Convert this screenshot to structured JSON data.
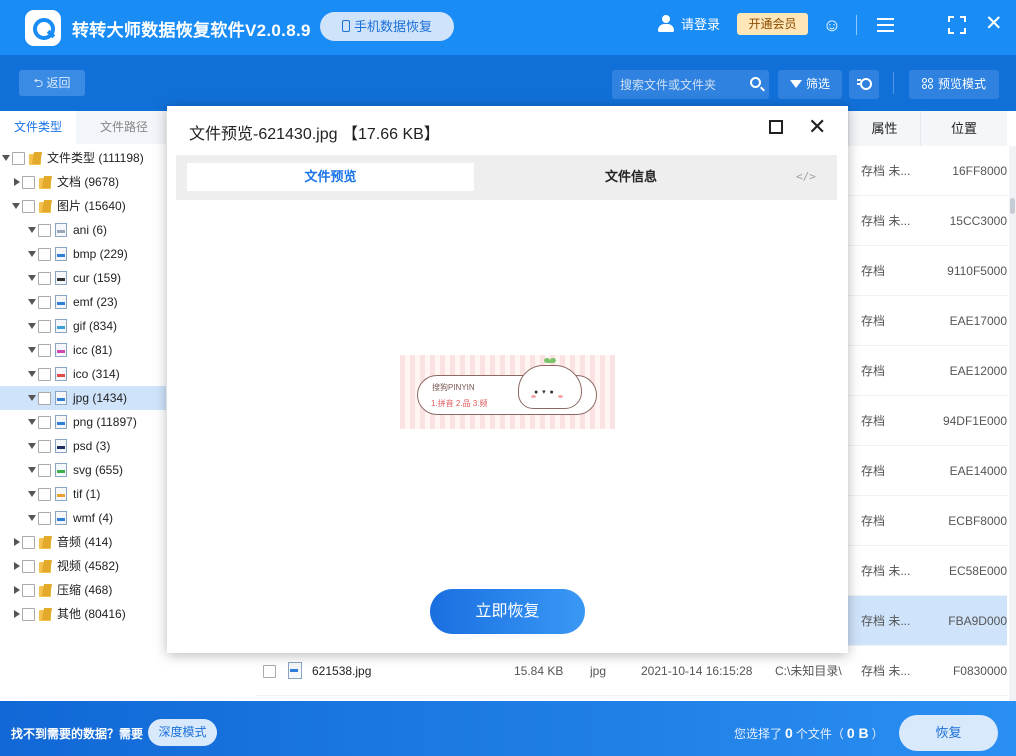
{
  "app": {
    "title": "转转大师数据恢复软件V2.0.8.9",
    "mobile_btn": "手机数据恢复",
    "login": "请登录",
    "vip": "开通会员"
  },
  "toolbar": {
    "back": "返回",
    "search_placeholder": "搜索文件或文件夹",
    "filter": "筛选",
    "preview_mode": "预览模式"
  },
  "left_tabs": {
    "file_type": "文件类型",
    "file_path": "文件路径"
  },
  "tree": [
    {
      "label": "文件类型 (111198)",
      "level": 0,
      "expand": "down",
      "icon": "folder"
    },
    {
      "label": "文档 (9678)",
      "level": 1,
      "expand": "right",
      "icon": "folder"
    },
    {
      "label": "图片 (15640)",
      "level": 1,
      "expand": "down",
      "icon": "folder"
    },
    {
      "label": "ani (6)",
      "level": 2,
      "expand": "down",
      "icon": "file",
      "color": "#9aa8b8"
    },
    {
      "label": "bmp (229)",
      "level": 2,
      "expand": "down",
      "icon": "file",
      "color": "#2f7fd8"
    },
    {
      "label": "cur (159)",
      "level": 2,
      "expand": "down",
      "icon": "file",
      "color": "#333333"
    },
    {
      "label": "emf (23)",
      "level": 2,
      "expand": "down",
      "icon": "file",
      "color": "#2f7fd8"
    },
    {
      "label": "gif (834)",
      "level": 2,
      "expand": "down",
      "icon": "file",
      "color": "#3aa0d8"
    },
    {
      "label": "icc (81)",
      "level": 2,
      "expand": "down",
      "icon": "file",
      "color": "#d04ab0"
    },
    {
      "label": "ico (314)",
      "level": 2,
      "expand": "down",
      "icon": "file",
      "color": "#e04848"
    },
    {
      "label": "jpg (1434)",
      "level": 2,
      "expand": "down",
      "icon": "file",
      "color": "#2f7fd8",
      "selected": true
    },
    {
      "label": "png (11897)",
      "level": 2,
      "expand": "down",
      "icon": "file",
      "color": "#2f7fd8"
    },
    {
      "label": "psd (3)",
      "level": 2,
      "expand": "down",
      "icon": "file",
      "color": "#1b2f5e"
    },
    {
      "label": "svg (655)",
      "level": 2,
      "expand": "down",
      "icon": "file",
      "color": "#3cb04a"
    },
    {
      "label": "tif (1)",
      "level": 2,
      "expand": "down",
      "icon": "file",
      "color": "#e8a030"
    },
    {
      "label": "wmf (4)",
      "level": 2,
      "expand": "down",
      "icon": "file",
      "color": "#2f7fd8"
    },
    {
      "label": "音频 (414)",
      "level": 1,
      "expand": "right",
      "icon": "folder"
    },
    {
      "label": "视频 (4582)",
      "level": 1,
      "expand": "right",
      "icon": "folder"
    },
    {
      "label": "压缩 (468)",
      "level": 1,
      "expand": "right",
      "icon": "folder"
    },
    {
      "label": "其他 (80416)",
      "level": 1,
      "expand": "right",
      "icon": "folder"
    }
  ],
  "table": {
    "columns": {
      "attr": "属性",
      "position": "位置"
    },
    "rows": [
      {
        "attr": "存档 未...",
        "pos": "16FF8000"
      },
      {
        "attr": "存档 未...",
        "pos": "15CC3000"
      },
      {
        "attr": "存档",
        "pos": "9110F5000"
      },
      {
        "attr": "存档",
        "pos": "EAE17000"
      },
      {
        "attr": "存档",
        "pos": "EAE12000"
      },
      {
        "attr": "存档",
        "pos": "94DF1E000"
      },
      {
        "attr": "存档",
        "pos": "EAE14000"
      },
      {
        "attr": "存档",
        "pos": "ECBF8000"
      },
      {
        "attr": "存档 未...",
        "pos": "EC58E000"
      },
      {
        "attr": "存档 未...",
        "pos": "FBA9D000",
        "selected": true
      }
    ],
    "last_row": {
      "name": "621538.jpg",
      "size": "15.84 KB",
      "type": "jpg",
      "date": "2021-10-14 16:15:28",
      "path": "C:\\未知目录\\",
      "attr": "存档 未...",
      "pos": "F0830000"
    }
  },
  "modal": {
    "title": "文件预览-621430.jpg 【17.66 KB】",
    "tab_preview": "文件预览",
    "tab_info": "文件信息",
    "code_icon": "</>",
    "image_text": {
      "brand": "搜狗PINYIN",
      "items": "1.拼音  2.品  3.频"
    },
    "restore": "立即恢复"
  },
  "bottom": {
    "no_data": "找不到需要的数据？需要",
    "deep_mode": "深度模式",
    "status_prefix": "您选择了",
    "count": "0",
    "status_mid": "个文件（",
    "size": "0 B",
    "status_end": "）",
    "recover": "恢复"
  }
}
